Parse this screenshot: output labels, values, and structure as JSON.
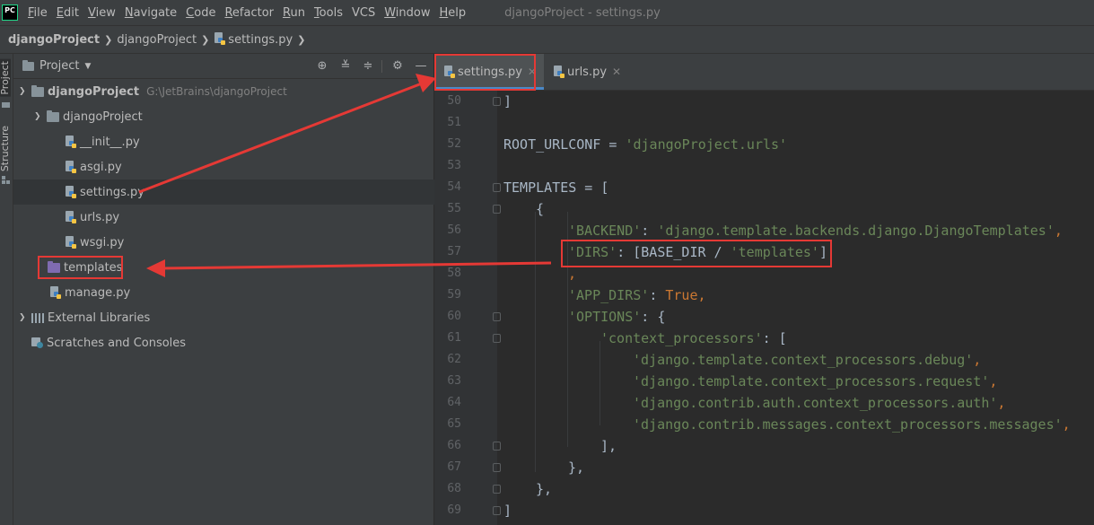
{
  "app": {
    "logo_text": "PC",
    "window_title": "djangoProject - settings.py"
  },
  "menu": [
    {
      "label": "File",
      "mnemonic": "F",
      "rest": "ile"
    },
    {
      "label": "Edit",
      "mnemonic": "E",
      "rest": "dit"
    },
    {
      "label": "View",
      "mnemonic": "V",
      "rest": "iew"
    },
    {
      "label": "Navigate",
      "mnemonic": "N",
      "rest": "avigate"
    },
    {
      "label": "Code",
      "mnemonic": "C",
      "rest": "ode"
    },
    {
      "label": "Refactor",
      "mnemonic": "R",
      "rest": "efactor"
    },
    {
      "label": "Run",
      "mnemonic": "R",
      "rest": "un"
    },
    {
      "label": "Tools",
      "mnemonic": "T",
      "rest": "ools"
    },
    {
      "label": "VCS",
      "mnemonic": "",
      "rest": "VCS"
    },
    {
      "label": "Window",
      "mnemonic": "W",
      "rest": "indow"
    },
    {
      "label": "Help",
      "mnemonic": "H",
      "rest": "elp"
    }
  ],
  "breadcrumbs": [
    "djangoProject",
    "djangoProject",
    "settings.py"
  ],
  "side_tabs": {
    "project": "Project",
    "structure": "Structure"
  },
  "project_panel": {
    "title": "Project",
    "tree": {
      "root_name": "djangoProject",
      "root_path": "G:\\JetBrains\\djangoProject",
      "package_name": "djangoProject",
      "files": [
        "__init__.py",
        "asgi.py",
        "settings.py",
        "urls.py",
        "wsgi.py"
      ],
      "templates_folder": "templates",
      "manage_file": "manage.py",
      "external_libraries": "External Libraries",
      "scratches": "Scratches and Consoles"
    }
  },
  "editor": {
    "tabs": [
      {
        "label": "settings.py",
        "active": true
      },
      {
        "label": "urls.py",
        "active": false
      }
    ],
    "line_numbers": [
      "50",
      "51",
      "52",
      "53",
      "54",
      "55",
      "56",
      "57",
      "58",
      "59",
      "60",
      "61",
      "62",
      "63",
      "64",
      "65",
      "66",
      "67",
      "68",
      "69"
    ],
    "code": {
      "l50": "]",
      "l52_name": "ROOT_URLCONF = ",
      "l52_str": "'djangoProject.urls'",
      "l54": "TEMPLATES = [",
      "l55": "{",
      "l56_key": "'BACKEND'",
      "l56_sep": ": ",
      "l56_val": "'django.template.backends.django.DjangoTemplates'",
      "l56_end": ",",
      "l57_key": "'DIRS'",
      "l57_mid": ": [BASE_DIR / ",
      "l57_val": "'templates'",
      "l57_end": "]",
      "l58": ",",
      "l59_key": "'APP_DIRS'",
      "l59_sep": ": ",
      "l59_val": "True",
      "l59_end": ",",
      "l60_key": "'OPTIONS'",
      "l60_rest": ": {",
      "l61_key": "'context_processors'",
      "l61_rest": ": [",
      "l62": "'django.template.context_processors.debug'",
      "l63": "'django.template.context_processors.request'",
      "l64": "'django.contrib.auth.context_processors.auth'",
      "l65": "'django.contrib.messages.context_processors.messages'",
      "comma": ",",
      "l66": "],",
      "l67": "},",
      "l68": "},",
      "l69": "]"
    }
  },
  "colors": {
    "annotation_red": "#e53935",
    "string_green": "#6a8759",
    "keyword_orange": "#cc7832",
    "tab_underline": "#4a88c7"
  }
}
